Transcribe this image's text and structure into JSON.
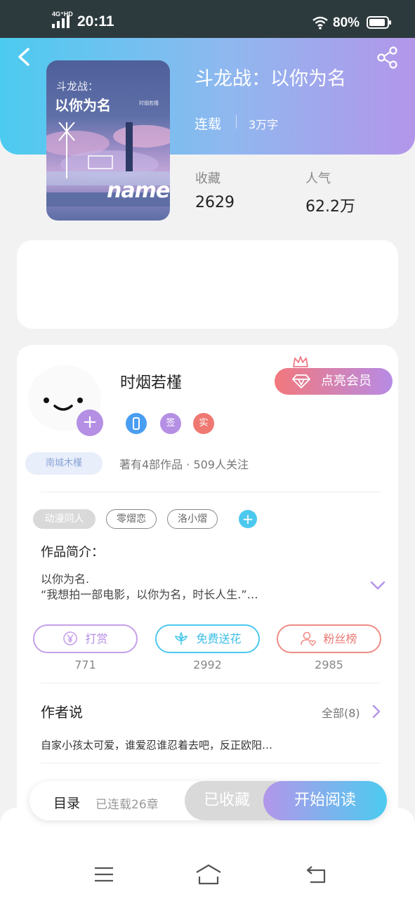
{
  "status_bar": {
    "network": "4G⁺HD",
    "time": "20:11",
    "battery": "80%"
  },
  "book": {
    "title": "斗龙战：以你为名",
    "status": "连载",
    "word_count": "3万字",
    "cover": {
      "title_line1": "斗龙战：",
      "title_line2": "以你为名",
      "author": "时烟若槿",
      "art_text": "name"
    },
    "stats": [
      {
        "label": "收藏",
        "value": "2629"
      },
      {
        "label": "人气",
        "value": "62.2万"
      }
    ]
  },
  "author": {
    "name": "时烟若槿",
    "fan_tag": "南城木槿",
    "vip_label": "点亮会员",
    "badges": [
      {
        "icon": "phone-badge-icon",
        "text": "",
        "color": "#4a9ef2"
      },
      {
        "icon": "signed-badge-icon",
        "text": "签",
        "color": "#b48fe3"
      },
      {
        "icon": "verified-badge-icon",
        "text": "实",
        "color": "#f07872"
      }
    ],
    "meta": "著有4部作品 · 509人关注"
  },
  "tags": [
    "动漫同人",
    "零熠恋",
    "洛小熠"
  ],
  "intro": {
    "title": "作品简介：",
    "text": "以你为名.\n“我想拍一部电影，以你为名，时长人生.”…"
  },
  "actions": [
    {
      "label": "打赏",
      "count": "771",
      "icon": "yen-icon",
      "color": "#c5a0e8"
    },
    {
      "label": "免费送花",
      "count": "2992",
      "icon": "flower-icon",
      "color": "#4cc8ee"
    },
    {
      "label": "粉丝榜",
      "count": "2985",
      "icon": "fans-icon",
      "color": "#ef8c86"
    }
  ],
  "author_says": {
    "title": "作者说",
    "all_label": "全部(8)",
    "text": "自家小孩太可爱，谁爱忍谁忍着去吧，反正欧阳…"
  },
  "bottom_bar": {
    "toc_label": "目录",
    "chapter_count": "已连载26章",
    "fav_label": "已收藏",
    "read_label": "开始阅读"
  },
  "colors": {
    "accent_blue": "#4ccbf0",
    "accent_purple": "#b396ea"
  }
}
